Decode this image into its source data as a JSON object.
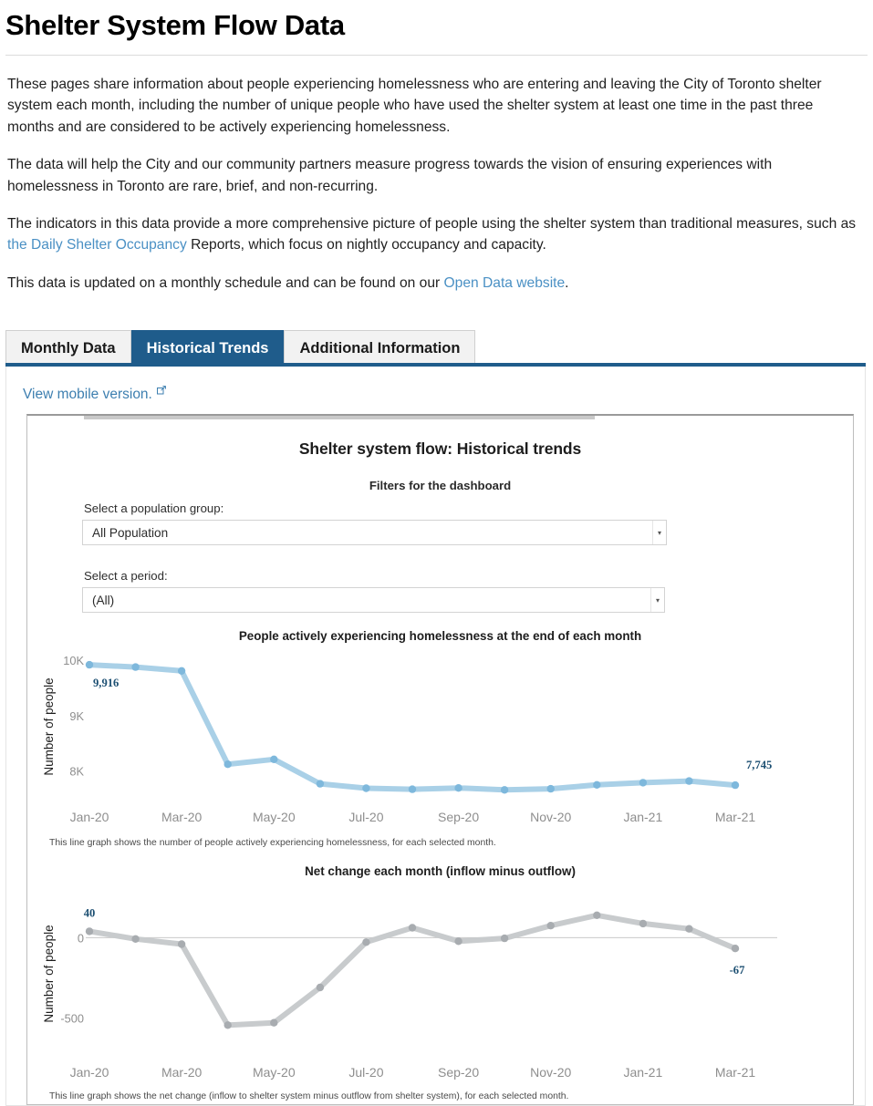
{
  "page": {
    "title": "Shelter System Flow Data",
    "paragraphs": [
      "These pages share information about people experiencing homelessness who are entering and leaving the City of Toronto shelter system each month, including the number of unique people who have used the shelter system at least one time in the past three months and are considered to be actively experiencing homelessness.",
      "The data will help the City and our community partners measure progress towards the vision of ensuring experiences with homelessness in Toronto are rare, brief, and non-recurring."
    ],
    "paragraph3": {
      "before": "The indicators in this data provide a more comprehensive picture of people using the shelter system than traditional measures, such as ",
      "link": "the Daily Shelter Occupancy",
      "after": " Reports, which focus on nightly occupancy and capacity."
    },
    "paragraph4": {
      "before": "This data is updated on a monthly schedule and can be found on our ",
      "link": "Open Data website",
      "after": "."
    }
  },
  "tabs": [
    {
      "label": "Monthly Data",
      "active": false
    },
    {
      "label": "Historical Trends",
      "active": true
    },
    {
      "label": "Additional Information",
      "active": false
    }
  ],
  "dashboard": {
    "mobile_link": "View mobile version.",
    "external_icon": "external-link-icon",
    "viz_title": "Shelter system flow: Historical trends",
    "filters_heading": "Filters for the dashboard",
    "filters": [
      {
        "label": "Select a population group:",
        "value": "All Population",
        "arrow": "▾"
      },
      {
        "label": "Select a period:",
        "value": "(All)",
        "arrow": "▾"
      }
    ]
  },
  "colors": {
    "tab_active": "#1f5c8b",
    "link": "#4a90c4",
    "chart1_line": "#9dc8e4",
    "chart2_line": "#c4c7c9",
    "endpoint_label": "#1c4f72",
    "tick": "#8e8e8e"
  },
  "chart_data": [
    {
      "type": "line",
      "title": "People actively experiencing homelessness at the end of each month",
      "caption": "This line graph shows the number of people actively experiencing homelessness, for each selected month.",
      "xlabel": "",
      "ylabel": "Number of people",
      "ylim": [
        7550,
        10050
      ],
      "yticks": [
        8000,
        9000,
        10000
      ],
      "ytick_labels": [
        "8K",
        "9K",
        "10K"
      ],
      "grid": false,
      "x": [
        "Jan-20",
        "Feb-20",
        "Mar-20",
        "Apr-20",
        "May-20",
        "Jun-20",
        "Jul-20",
        "Aug-20",
        "Sep-20",
        "Oct-20",
        "Nov-20",
        "Dec-20",
        "Jan-21",
        "Feb-21",
        "Mar-21"
      ],
      "xtick_labels": [
        "Jan-20",
        "Mar-20",
        "May-20",
        "Jul-20",
        "Sep-20",
        "Nov-20",
        "Jan-21",
        "Mar-21"
      ],
      "values": [
        9916,
        9876,
        9806,
        8123,
        8211,
        7770,
        7690,
        7672,
        7695,
        7660,
        7680,
        7750,
        7790,
        7820,
        7745
      ],
      "annotations": [
        {
          "index": 0,
          "text": "9,916"
        },
        {
          "index": 14,
          "text": "7,745"
        }
      ]
    },
    {
      "type": "line",
      "title": "Net change each month (inflow minus outflow)",
      "caption": "This line graph shows the net change (inflow to shelter system minus outflow from shelter system), for each selected month.",
      "xlabel": "",
      "ylabel": "Number of people",
      "ylim": [
        -640,
        190
      ],
      "yticks": [
        0,
        -500
      ],
      "ytick_labels": [
        "0",
        "-500"
      ],
      "grid": false,
      "x": [
        "Jan-20",
        "Feb-20",
        "Mar-20",
        "Apr-20",
        "May-20",
        "Jun-20",
        "Jul-20",
        "Aug-20",
        "Sep-20",
        "Oct-20",
        "Nov-20",
        "Dec-20",
        "Jan-21",
        "Feb-21",
        "Mar-21"
      ],
      "xtick_labels": [
        "Jan-20",
        "Mar-20",
        "May-20",
        "Jul-20",
        "Sep-20",
        "Nov-20",
        "Jan-21",
        "Mar-21"
      ],
      "values": [
        40,
        -8,
        -40,
        -545,
        -530,
        -310,
        -28,
        62,
        -22,
        -4,
        75,
        140,
        88,
        55,
        -67
      ],
      "annotations": [
        {
          "index": 0,
          "text": "40"
        },
        {
          "index": 14,
          "text": "-67"
        }
      ]
    }
  ]
}
